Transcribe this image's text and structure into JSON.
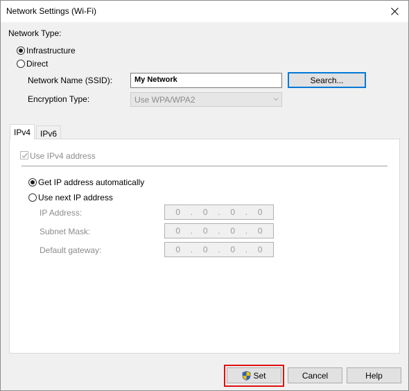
{
  "window": {
    "title": "Network Settings (Wi-Fi)"
  },
  "network_type": {
    "label": "Network Type:",
    "options": [
      "Infrastructure",
      "Direct"
    ],
    "selected": "Infrastructure"
  },
  "ssid": {
    "label": "Network Name (SSID):",
    "value": "My Network",
    "search_label": "Search..."
  },
  "encryption": {
    "label": "Encryption Type:",
    "value": "Use WPA/WPA2"
  },
  "tabs": [
    {
      "label": "IPv4"
    },
    {
      "label": "IPv6"
    }
  ],
  "ipv4": {
    "use_label": "Use IPv4 address",
    "auto_label": "Get IP address automatically",
    "manual_label": "Use next IP address",
    "fields": [
      {
        "label": "IP Address:",
        "octets": [
          "0",
          "0",
          "0",
          "0"
        ]
      },
      {
        "label": "Subnet Mask:",
        "octets": [
          "0",
          "0",
          "0",
          "0"
        ]
      },
      {
        "label": "Default gateway:",
        "octets": [
          "0",
          "0",
          "0",
          "0"
        ]
      }
    ],
    "dot": "."
  },
  "buttons": {
    "set": "Set",
    "cancel": "Cancel",
    "help": "Help"
  },
  "colors": {
    "highlight": "#e01010",
    "focus": "#0078d7"
  },
  "icons": {
    "close": "close-icon",
    "shield": "uac-shield-icon",
    "dropdown": "chevron-down-icon"
  }
}
